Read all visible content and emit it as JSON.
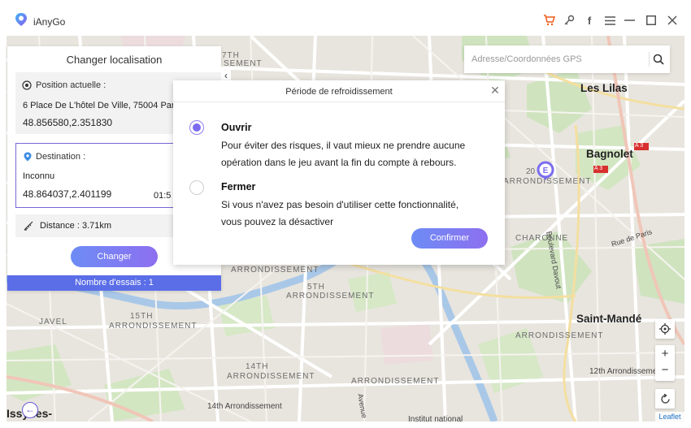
{
  "app": {
    "title": "iAnyGo",
    "accent_color": "#7a6cf0",
    "icons": [
      "cart-icon",
      "key-icon",
      "facebook-icon",
      "menu-icon",
      "maximize-icon",
      "close-icon"
    ]
  },
  "left_panel": {
    "title": "Changer localisation",
    "current": {
      "label": "Position actuelle :",
      "address": "6 Place De L'hôtel De Ville, 75004 Paris",
      "coords": "48.856580,2.351830"
    },
    "destination": {
      "label": "Destination :",
      "name": "Inconnu",
      "coords": "48.864037,2.401199",
      "time": "01:5"
    },
    "distance": "Distance : 3.71km",
    "change_button": "Changer",
    "tries": "Nombre d'essais : 1"
  },
  "search": {
    "placeholder": "Adresse/Coordonnées GPS"
  },
  "dialog": {
    "title": "Période de refroidissement",
    "option_on": {
      "title": "Ouvrir",
      "desc_line1": "Pour éviter des risques, il vaut mieux ne prendre aucune",
      "desc_line2": "opération dans le jeu avant la fin du compte à rebours."
    },
    "option_off": {
      "title": "Fermer",
      "desc_line1": "Si vous n'avez pas besoin d'utiliser cette fonctionnalité,",
      "desc_line2": "vous pouvez la désactiver"
    },
    "confirm": "Confirmer"
  },
  "map": {
    "labels": {
      "seventh": "7TH",
      "seventh_arr": "SEMENT",
      "les_lilas": "Les Lilas",
      "bagnolet": "Bagnolet",
      "a3_top": "A 3",
      "a3_mid": "A 3",
      "twentieth_num": "20",
      "twentieth_arr": "ARRONDISSEMENT",
      "charonne": "CHARONNE",
      "boulevard_davout": "Boulevard Davout",
      "rue_de_paris": "Rue de Paris",
      "arr_left": "ARRONDISSEMENT",
      "fifth": "5TH",
      "fifth_arr": "ARRONDISSEMENT",
      "fifteenth": "15TH",
      "javel": "JAVEL",
      "fifteenth_arr": "ARRONDISSEMENT",
      "saint_mande": "Saint-Mandé",
      "twelfth_arr_caps": "ARRONDISSEMENT",
      "fourteenth": "14TH",
      "fourteenth_arr": "ARRONDISSEMENT",
      "thirteenth_arr": "ARRONDISSEMENT",
      "twelfth_arr": "12th Arrondissement",
      "fourteenth_arr_lower": "14th Arrondissement",
      "issy": "Issy-les-",
      "avenue": "Avenue",
      "institut": "Institut national",
      "marker_letter": "E"
    },
    "attribution": "Leaflet"
  }
}
